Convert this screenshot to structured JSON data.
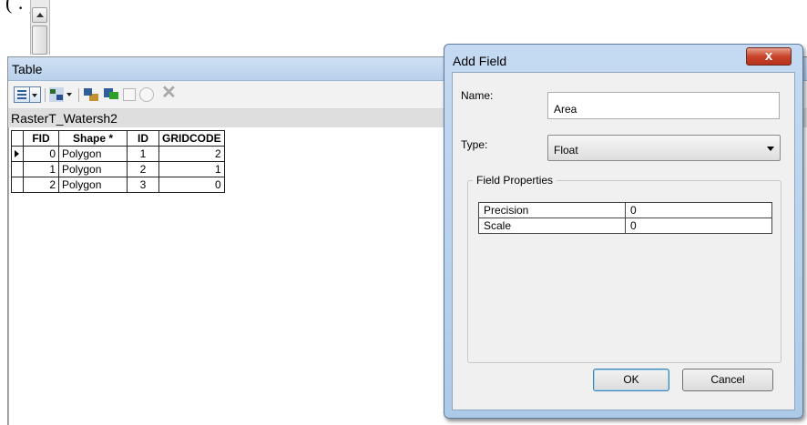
{
  "background_fragment": "(      .                        )",
  "table_window": {
    "title": "Table",
    "tab_name": "RasterT_Watersh2",
    "toolbar_icons": [
      "table-options-icon",
      "related-tables-icon",
      "select-by-attributes-icon",
      "switch-selection-icon",
      "clear-selection-icon",
      "zoom-to-selected-icon",
      "delete-selected-icon"
    ],
    "columns": [
      "FID",
      "Shape *",
      "ID",
      "GRIDCODE"
    ],
    "rows": [
      {
        "fid": "0",
        "shape": "Polygon",
        "id": "1",
        "gridcode": "2",
        "current": true
      },
      {
        "fid": "1",
        "shape": "Polygon",
        "id": "2",
        "gridcode": "1",
        "current": false
      },
      {
        "fid": "2",
        "shape": "Polygon",
        "id": "3",
        "gridcode": "0",
        "current": false
      }
    ]
  },
  "dialog": {
    "title": "Add Field",
    "close_label": "x",
    "name_label": "Name:",
    "name_value": "Area",
    "type_label": "Type:",
    "type_value": "Float",
    "field_properties_label": "Field Properties",
    "properties": [
      {
        "key": "Precision",
        "value": "0"
      },
      {
        "key": "Scale",
        "value": "0"
      }
    ],
    "ok_label": "OK",
    "cancel_label": "Cancel"
  },
  "colors": {
    "title_bar": "#c5daf2",
    "close_button": "#c9442a",
    "window_bg": "#f0f0f0"
  }
}
